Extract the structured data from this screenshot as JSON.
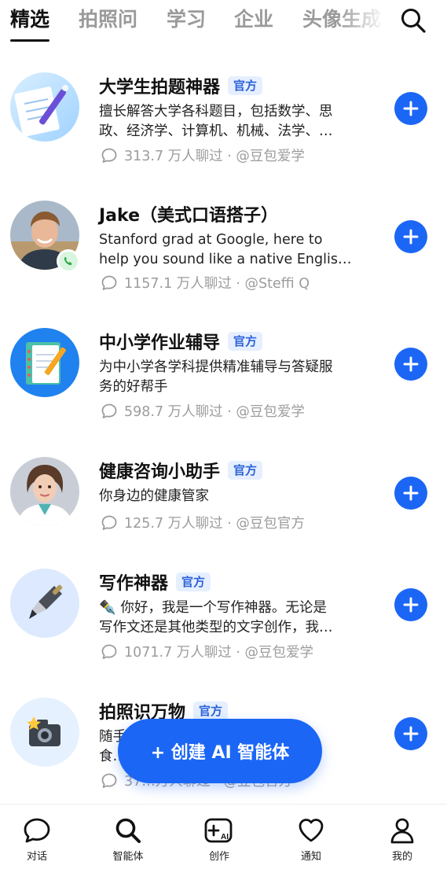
{
  "tabs": [
    {
      "label": "精选",
      "active": true
    },
    {
      "label": "拍照问",
      "active": false
    },
    {
      "label": "学习",
      "active": false
    },
    {
      "label": "企业",
      "active": false
    },
    {
      "label": "头像生成",
      "active": false
    }
  ],
  "header": {
    "search_icon": "search-icon"
  },
  "items": [
    {
      "title": "大学生拍题神器",
      "badge": "官方",
      "desc_line1": "擅长解答大学各科题目，包括数学、思",
      "desc_line2": "政、经济学、计算机、机械、法学、…",
      "stats": "313.7 万人聊过 · @豆包爱学",
      "avatar_icon": "math-paper-pen-icon"
    },
    {
      "title": "Jake（美式口语搭子）",
      "badge": "",
      "desc_line1": "Stanford grad at Google, here to",
      "desc_line2": "help you sound like a native Englis…",
      "stats": "1157.1 万人聊过 · @Steffi Q",
      "avatar_icon": "person-photo-icon"
    },
    {
      "title": "中小学作业辅导",
      "badge": "官方",
      "desc_line1": "为中小学各学科提供精准辅导与答疑服",
      "desc_line2": "务的好帮手",
      "stats": "598.7 万人聊过 · @豆包爱学",
      "avatar_icon": "notebook-pencil-icon"
    },
    {
      "title": "健康咨询小助手",
      "badge": "官方",
      "desc_line1": "你身边的健康管家",
      "desc_line2": "",
      "stats": "125.7 万人聊过 · @豆包官方",
      "avatar_icon": "doctor-avatar-icon"
    },
    {
      "title": "写作神器",
      "badge": "官方",
      "desc_line1": "✒️ 你好，我是一个写作神器。无论是",
      "desc_line2": "写作文还是其他类型的文字创作，我…",
      "stats": "1071.7 万人聊过 · @豆包爱学",
      "avatar_icon": "fountain-pen-icon"
    },
    {
      "title": "拍照识万物",
      "badge": "官方",
      "desc_line1": "随手拍照识别植物、动物、美",
      "desc_line2": "食…",
      "stats": "37…万人聊过 · @豆包官方",
      "avatar_icon": "camera-icon"
    }
  ],
  "create_button": {
    "label": "+ 创建 AI 智能体"
  },
  "bottom_nav": [
    {
      "label": "对话",
      "icon": "chat-bubble-icon"
    },
    {
      "label": "智能体",
      "icon": "search-icon"
    },
    {
      "label": "创作",
      "icon": "create-ai-icon"
    },
    {
      "label": "通知",
      "icon": "heart-icon"
    },
    {
      "label": "我的",
      "icon": "person-icon"
    }
  ],
  "colors": {
    "accent": "#1b66f5",
    "badge_bg": "#e6efff",
    "badge_text": "#2c62d9",
    "muted": "#9c9c9c"
  }
}
